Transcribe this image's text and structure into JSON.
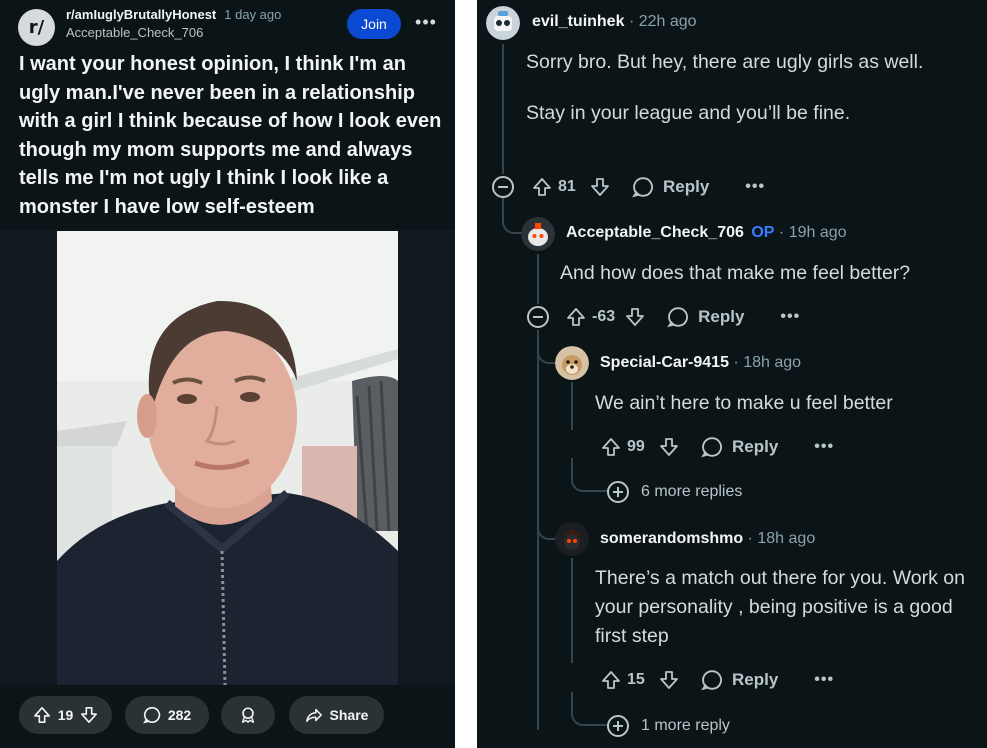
{
  "post": {
    "subreddit": "r/amIuglyBrutallyHonest",
    "subreddit_icon_text": "r/",
    "time": "1 day ago",
    "author": "Acceptable_Check_706",
    "join_label": "Join",
    "more_label": "•••",
    "title": "I want your honest opinion, I think I'm an ugly man.I've never been in a relationship with a girl I think because of how I look even though my mom supports me and always tells me I'm not ugly I think I look like a monster I have low self-esteem",
    "votes": "19",
    "comments": "282",
    "share_label": "Share",
    "icons": [
      "upvote-icon",
      "downvote-icon",
      "comment-icon",
      "award-icon",
      "share-icon"
    ]
  },
  "comments": [
    {
      "author": "evil_tuinhek",
      "op_badge": "",
      "time": "22h ago",
      "body": [
        "Sorry bro. But hey, there are ugly girls as well.",
        "Stay in your league and you’ll be fine."
      ],
      "score": "81",
      "reply_label": "Reply",
      "more_label": "•••"
    },
    {
      "author": "Acceptable_Check_706",
      "op_badge": "OP",
      "time": "19h ago",
      "body": [
        "And how does that make me feel better?"
      ],
      "score": "-63",
      "reply_label": "Reply",
      "more_label": "•••"
    },
    {
      "author": "Special-Car-9415",
      "op_badge": "",
      "time": "18h ago",
      "body": [
        "We ain’t here to make u feel better"
      ],
      "score": "99",
      "reply_label": "Reply",
      "more_label": "•••"
    },
    {
      "author": "somerandomshmo",
      "op_badge": "",
      "time": "18h ago",
      "body": [
        "There’s a match out there for you. Work on your personality , being positive is a good first step"
      ],
      "score": "15",
      "reply_label": "Reply",
      "more_label": "•••"
    }
  ],
  "more_replies": [
    "6 more replies",
    "1 more reply"
  ],
  "separator": "·",
  "colors": {
    "background": "#0b1416",
    "join_button": "#0a49d1",
    "op_badge": "#3a7bff",
    "pill": "#2a3236"
  }
}
